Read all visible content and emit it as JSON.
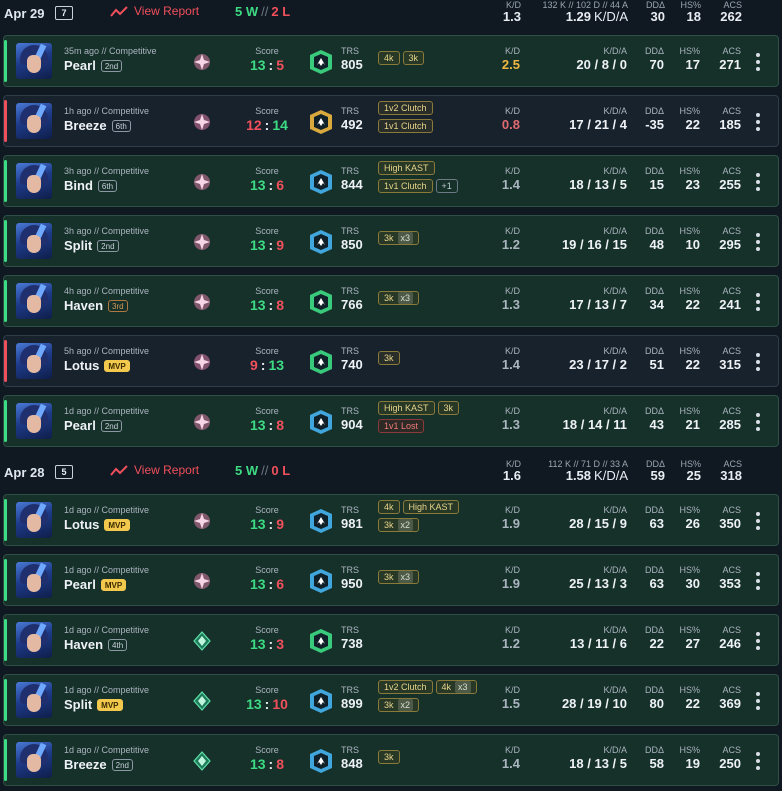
{
  "days": [
    {
      "date": "Apr 29",
      "count": "7",
      "view_report": "View Report",
      "wins": "5 W",
      "sep": "//",
      "losses": "2 L",
      "kd_caption": "K/D",
      "kd": "1.3",
      "kda_caption": "132 K // 102 D // 44 A",
      "kda_value": "1.29",
      "kda_label": "K/D/A",
      "ddd_caption": "DDΔ",
      "ddd": "30",
      "hs_caption": "HS%",
      "hs": "18",
      "acs_caption": "ACS",
      "acs": "262"
    },
    {
      "date": "Apr 28",
      "count": "5",
      "view_report": "View Report",
      "wins": "5 W",
      "sep": "//",
      "losses": "0 L",
      "kd_caption": "K/D",
      "kd": "1.6",
      "kda_caption": "112 K // 71 D // 33 A",
      "kda_value": "1.58",
      "kda_label": "K/D/A",
      "ddd_caption": "DDΔ",
      "ddd": "59",
      "hs_caption": "HS%",
      "hs": "25",
      "acs_caption": "ACS",
      "acs": "318"
    }
  ],
  "labels": {
    "score": "Score",
    "trs": "TRS",
    "kd": "K/D",
    "kda": "K/D/A",
    "ddd": "DDΔ",
    "hs": "HS%",
    "acs": "ACS"
  },
  "matches": [
    {
      "ago": "35m ago // Competitive",
      "map": "Pearl",
      "place": "2nd",
      "place_style": "normal",
      "result": "win",
      "score_a": "13",
      "score_b": "5",
      "trs": "805",
      "trs_color": "#3ddc84",
      "rank_icon": "radiant-gem-icon",
      "tags": [
        [
          "4k",
          "3k"
        ]
      ],
      "kd": "2.5",
      "kd_style": "good",
      "kda": "20 / 8 / 0",
      "ddd": "70",
      "hs": "17",
      "acs": "271"
    },
    {
      "ago": "1h ago // Competitive",
      "map": "Breeze",
      "place": "6th",
      "place_style": "normal",
      "result": "loss",
      "score_a": "12",
      "score_b": "14",
      "trs": "492",
      "trs_color": "#f0b840",
      "rank_icon": "radiant-gem-icon",
      "tags": [
        [
          "1v2 Clutch"
        ],
        [
          "1v1 Clutch"
        ]
      ],
      "kd": "0.8",
      "kd_style": "bad",
      "kda": "17 / 21 / 4",
      "ddd": "-35",
      "hs": "22",
      "acs": "185"
    },
    {
      "ago": "3h ago // Competitive",
      "map": "Bind",
      "place": "6th",
      "place_style": "normal",
      "result": "win",
      "score_a": "13",
      "score_b": "6",
      "trs": "844",
      "trs_color": "#46b4f0",
      "rank_icon": "radiant-gem-icon",
      "tags": [
        [
          "High KAST"
        ],
        [
          "1v1 Clutch",
          "+1"
        ]
      ],
      "kd": "1.4",
      "kd_style": "mid",
      "kda": "18 / 13 / 5",
      "ddd": "15",
      "hs": "23",
      "acs": "255"
    },
    {
      "ago": "3h ago // Competitive",
      "map": "Split",
      "place": "2nd",
      "place_style": "normal",
      "result": "win",
      "score_a": "13",
      "score_b": "9",
      "trs": "850",
      "trs_color": "#46b4f0",
      "rank_icon": "radiant-gem-icon",
      "tags": [
        [
          "3k|x3"
        ]
      ],
      "kd": "1.2",
      "kd_style": "mid",
      "kda": "19 / 16 / 15",
      "ddd": "48",
      "hs": "10",
      "acs": "295"
    },
    {
      "ago": "4h ago // Competitive",
      "map": "Haven",
      "place": "3rd",
      "place_style": "bronze",
      "result": "win",
      "score_a": "13",
      "score_b": "8",
      "trs": "766",
      "trs_color": "#3ddc84",
      "rank_icon": "radiant-gem-icon",
      "tags": [
        [
          "3k|x3"
        ]
      ],
      "kd": "1.3",
      "kd_style": "mid",
      "kda": "17 / 13 / 7",
      "ddd": "34",
      "hs": "22",
      "acs": "241"
    },
    {
      "ago": "5h ago // Competitive",
      "map": "Lotus",
      "place": "MVP",
      "place_style": "mvp",
      "result": "loss",
      "score_a": "9",
      "score_b": "13",
      "trs": "740",
      "trs_color": "#3ddc84",
      "rank_icon": "radiant-gem-icon",
      "tags": [
        [
          "3k"
        ]
      ],
      "kd": "1.4",
      "kd_style": "mid",
      "kda": "23 / 17 / 2",
      "ddd": "51",
      "hs": "22",
      "acs": "315"
    },
    {
      "ago": "1d ago // Competitive",
      "map": "Pearl",
      "place": "2nd",
      "place_style": "normal",
      "result": "win",
      "score_a": "13",
      "score_b": "8",
      "trs": "904",
      "trs_color": "#46b4f0",
      "rank_icon": "radiant-gem-icon",
      "tags": [
        [
          "High KAST",
          "3k"
        ],
        [
          "!1v1 Lost"
        ]
      ],
      "kd": "1.3",
      "kd_style": "mid",
      "kda": "18 / 14 / 11",
      "ddd": "43",
      "hs": "21",
      "acs": "285"
    },
    {
      "ago": "1d ago // Competitive",
      "map": "Lotus",
      "place": "MVP",
      "place_style": "mvp",
      "result": "win",
      "score_a": "13",
      "score_b": "9",
      "trs": "981",
      "trs_color": "#46b4f0",
      "rank_icon": "radiant-gem-icon",
      "tags": [
        [
          "4k",
          "High KAST"
        ],
        [
          "3k|x2"
        ]
      ],
      "kd": "1.9",
      "kd_style": "mid",
      "kda": "28 / 15 / 9",
      "ddd": "63",
      "hs": "26",
      "acs": "350"
    },
    {
      "ago": "1d ago // Competitive",
      "map": "Pearl",
      "place": "MVP",
      "place_style": "mvp",
      "result": "win",
      "score_a": "13",
      "score_b": "6",
      "trs": "950",
      "trs_color": "#46b4f0",
      "rank_icon": "radiant-gem-icon",
      "tags": [
        [
          "3k|x3"
        ]
      ],
      "kd": "1.9",
      "kd_style": "mid",
      "kda": "25 / 13 / 3",
      "ddd": "63",
      "hs": "30",
      "acs": "353"
    },
    {
      "ago": "1d ago // Competitive",
      "map": "Haven",
      "place": "4th",
      "place_style": "normal",
      "result": "win",
      "score_a": "13",
      "score_b": "3",
      "trs": "738",
      "trs_color": "#3ddc84",
      "rank_icon": "ascendant-gem-icon",
      "tags": [],
      "kd": "1.2",
      "kd_style": "mid",
      "kda": "13 / 11 / 6",
      "ddd": "22",
      "hs": "27",
      "acs": "246"
    },
    {
      "ago": "1d ago // Competitive",
      "map": "Split",
      "place": "MVP",
      "place_style": "mvp",
      "result": "win",
      "score_a": "13",
      "score_b": "10",
      "trs": "899",
      "trs_color": "#46b4f0",
      "rank_icon": "ascendant-gem-icon",
      "tags": [
        [
          "1v2 Clutch",
          "4k|x3"
        ],
        [
          "3k|x2"
        ]
      ],
      "kd": "1.5",
      "kd_style": "mid",
      "kda": "28 / 19 / 10",
      "ddd": "80",
      "hs": "22",
      "acs": "369"
    },
    {
      "ago": "1d ago // Competitive",
      "map": "Breeze",
      "place": "2nd",
      "place_style": "normal",
      "result": "win",
      "score_a": "13",
      "score_b": "8",
      "trs": "848",
      "trs_color": "#46b4f0",
      "rank_icon": "ascendant-gem-icon",
      "tags": [
        [
          "3k"
        ]
      ],
      "kd": "1.4",
      "kd_style": "mid",
      "kda": "18 / 13 / 5",
      "ddd": "58",
      "hs": "19",
      "acs": "250"
    }
  ]
}
